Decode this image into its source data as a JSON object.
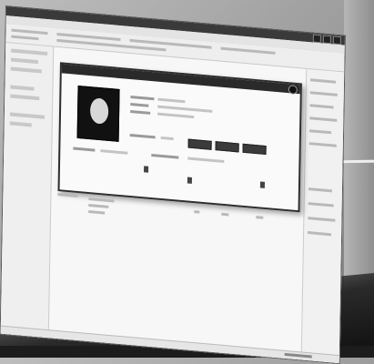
{
  "window": {
    "title": "",
    "menu_items": []
  },
  "dialog": {
    "title": "",
    "fields": [],
    "buttons": []
  },
  "status_bar": {
    "text": ""
  },
  "icons": [
    "window-minimize-icon",
    "window-maximize-icon",
    "window-close-icon",
    "dialog-close-icon",
    "person-photo-icon"
  ]
}
